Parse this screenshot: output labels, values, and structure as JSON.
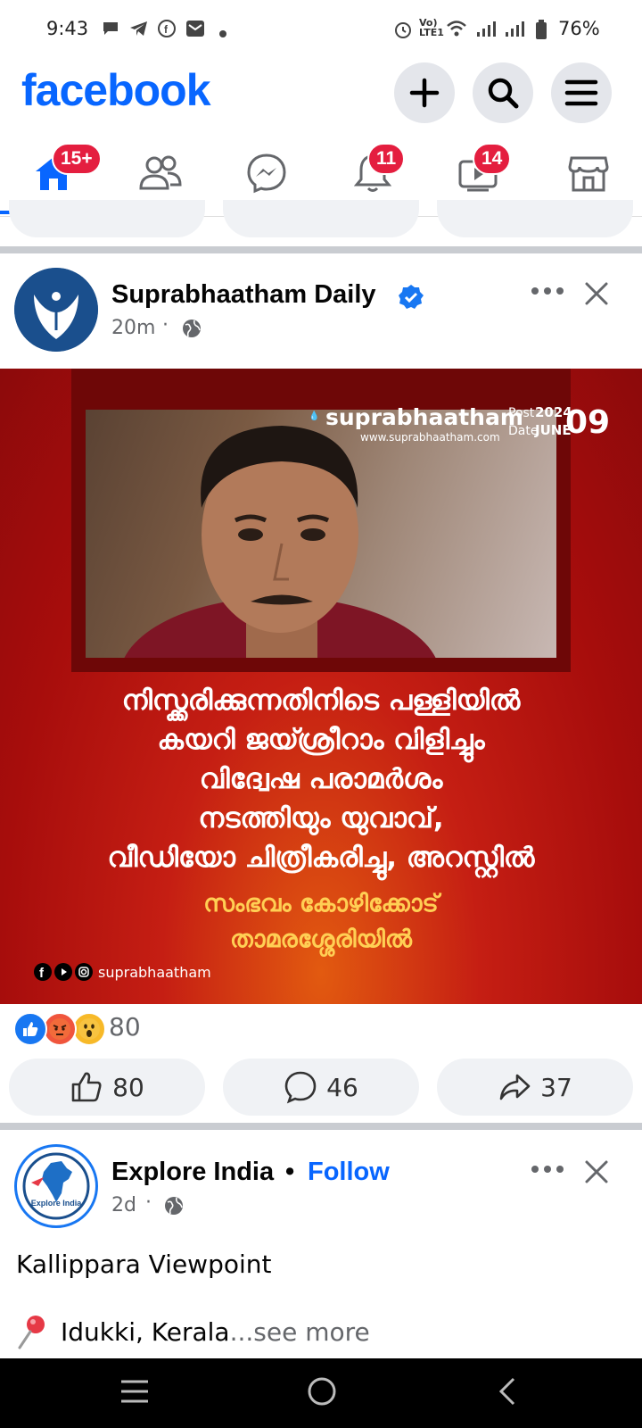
{
  "status_bar": {
    "time": "9:43",
    "battery": "76%",
    "left_icons": [
      "chat-icon",
      "telegram-icon",
      "facebook-icon",
      "mail-icon",
      "dot-icon"
    ],
    "right_icons": [
      "alarm-icon",
      "volte-icon",
      "wifi-icon",
      "signal-icon",
      "signal-icon",
      "battery-icon"
    ]
  },
  "header": {
    "logo": "facebook",
    "buttons": [
      "plus-icon",
      "search-icon",
      "menu-icon"
    ]
  },
  "nav": {
    "items": [
      {
        "name": "home",
        "badge": "15+",
        "active": true
      },
      {
        "name": "friends",
        "badge": ""
      },
      {
        "name": "messenger",
        "badge": ""
      },
      {
        "name": "notifications",
        "badge": "11"
      },
      {
        "name": "video",
        "badge": "14"
      },
      {
        "name": "marketplace",
        "badge": ""
      }
    ]
  },
  "post1": {
    "author": "Suprabhaatham Daily",
    "verified": true,
    "time": "20m",
    "image": {
      "brand": "suprabhaatham",
      "website": "www.suprabhaatham.com",
      "post_date_label_1": "Post",
      "post_date_label_2": "Date",
      "year": "2024",
      "month": "JUNE",
      "day": "09",
      "headline_lines": [
        "നിസ്ക്കരിക്കുന്നതിനിടെ പള്ളിയിൽ",
        "കയറി ജയ്ശ്രീറാം വിളിച്ചും",
        "വിദ്വേഷ പരാമർശം",
        "നടത്തിയും യുവാവ്,",
        "വീഡിയോ ചിത്രീകരിച്ചു, അറസ്റ്റിൽ"
      ],
      "sub_lines": [
        "സംഭവം കോഴിക്കോട്",
        "താമരശ്ശേരിയിൽ"
      ],
      "social_handle": "suprabhaatham"
    },
    "reactions_count": "80",
    "actions": {
      "like": "80",
      "comment": "46",
      "share": "37"
    }
  },
  "post2": {
    "author": "Explore India",
    "bullet": "•",
    "follow": "Follow",
    "time": "2d",
    "logo_text": "Explore India",
    "text_line1": "Kallippara Viewpoint",
    "text_line2": "Idukki, Kerala",
    "see_more": "...see more"
  },
  "colors": {
    "brand_blue": "#0866ff",
    "badge_red": "#e41e3f",
    "post_red": "#b51010",
    "headline_yellow": "#ffcf54"
  }
}
